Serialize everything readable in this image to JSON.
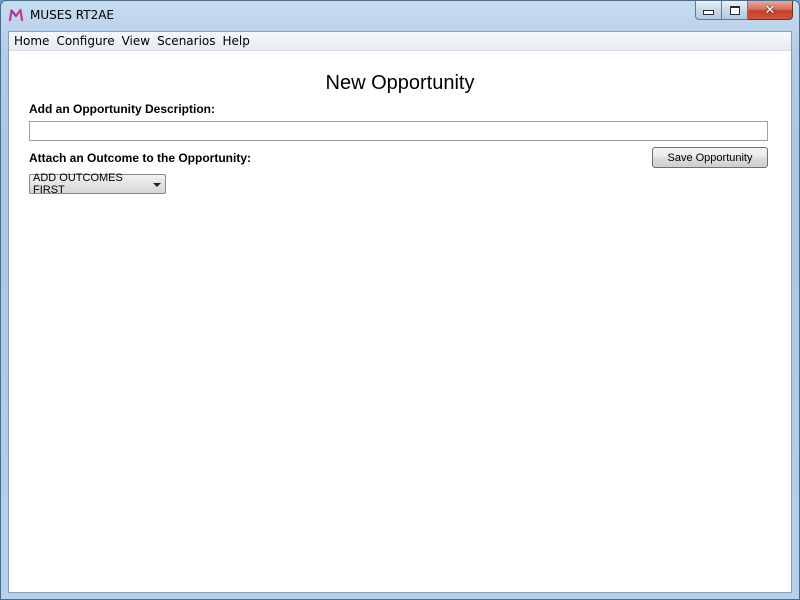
{
  "window": {
    "title": "MUSES RT2AE",
    "icon": "muses-logo-icon",
    "minimize_glyph": "",
    "maximize_glyph": "",
    "close_glyph": "✕"
  },
  "menubar": {
    "items": [
      {
        "label": "Home"
      },
      {
        "label": "Configure"
      },
      {
        "label": "View"
      },
      {
        "label": "Scenarios"
      },
      {
        "label": "Help"
      }
    ]
  },
  "main": {
    "title": "New Opportunity",
    "description_label": "Add an Opportunity Description:",
    "description_value": "",
    "outcome_label": "Attach an Outcome to the Opportunity:",
    "outcome_selected": "ADD OUTCOMES FIRST",
    "save_label": "Save Opportunity"
  },
  "colors": {
    "logo_accent": "#c2378f",
    "close_button": "#c4402a"
  }
}
